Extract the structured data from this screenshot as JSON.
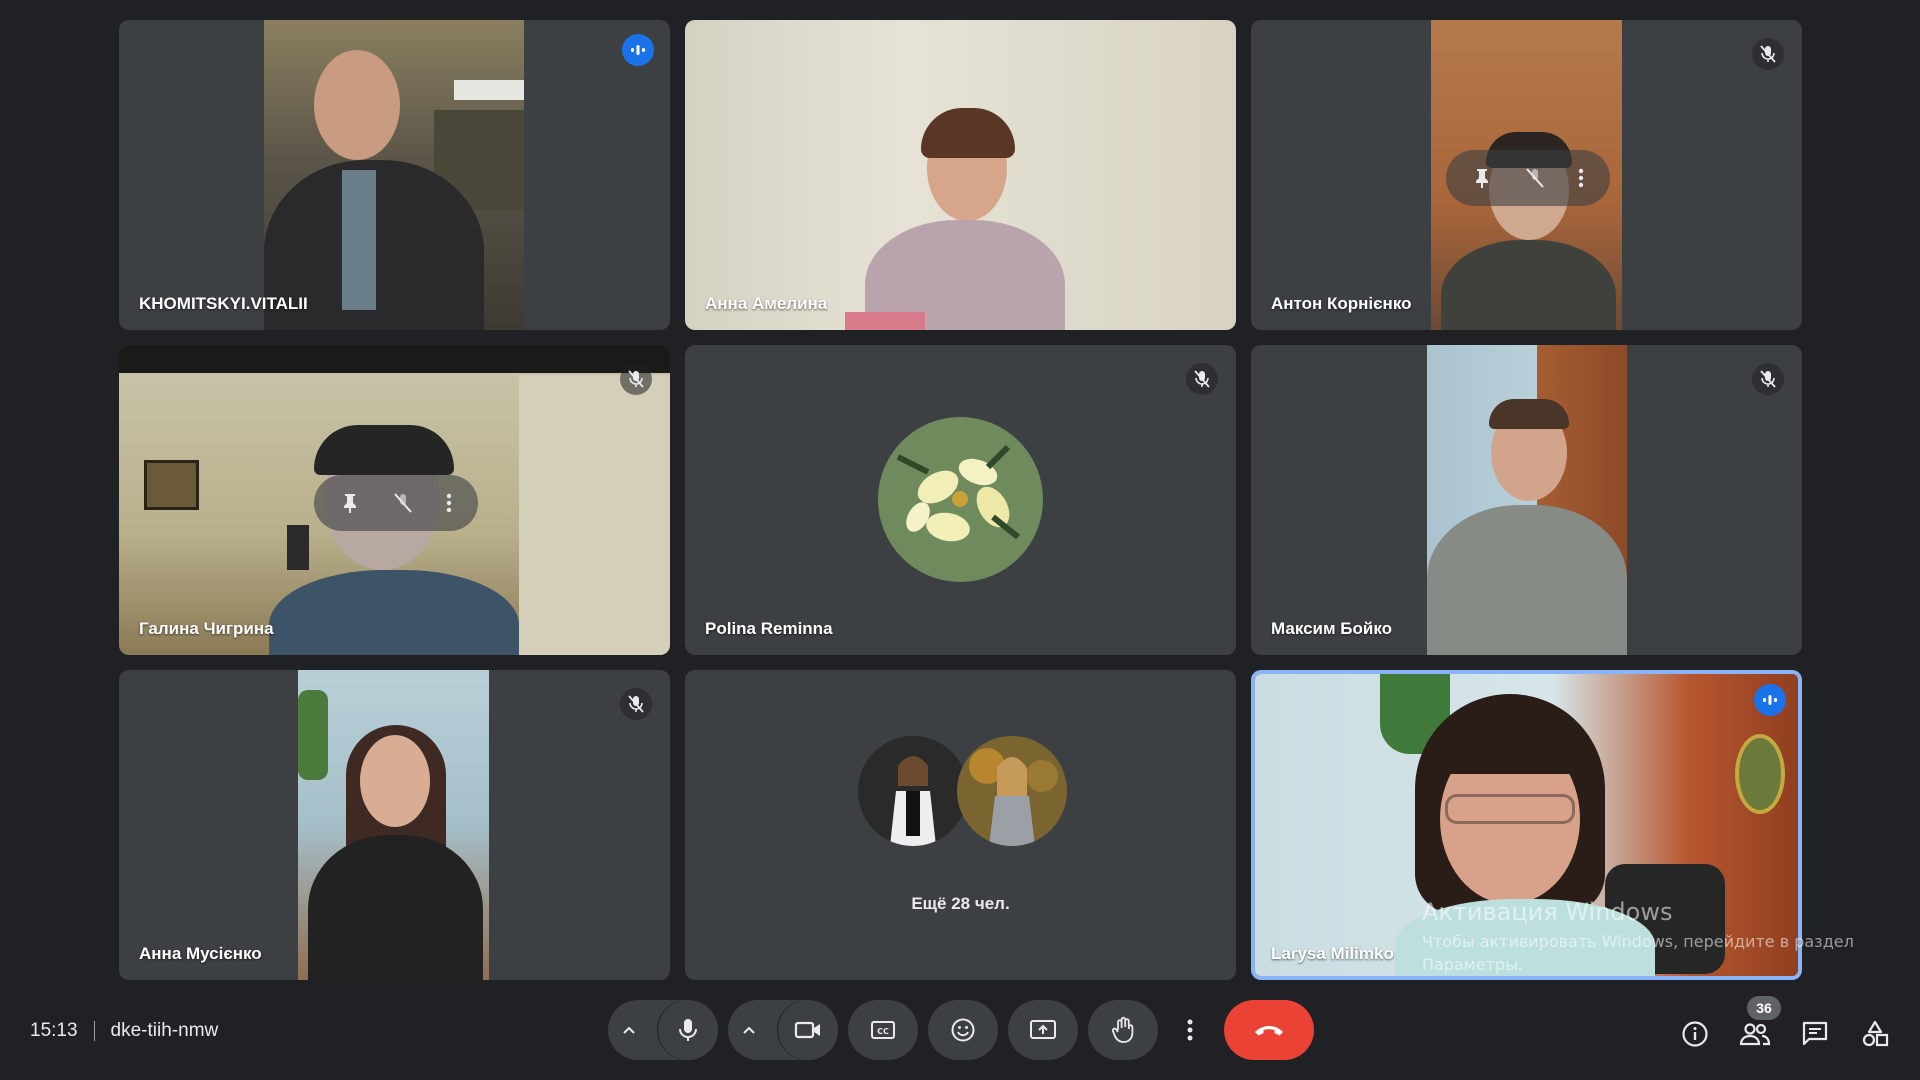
{
  "meeting": {
    "time": "15:13",
    "code": "dke-tiih-nmw"
  },
  "participants": [
    {
      "name": "KHOMITSKYI.VITALII",
      "state": "speaking"
    },
    {
      "name": "Анна Амелина",
      "state": "none"
    },
    {
      "name": "Антон Корнієнко",
      "state": "muted"
    },
    {
      "name": "Галина Чигрина",
      "state": "muted"
    },
    {
      "name": "Polina Reminna",
      "state": "muted"
    },
    {
      "name": "Максим Бойко",
      "state": "muted"
    },
    {
      "name": "Анна Мусієнко",
      "state": "muted"
    },
    {
      "name": "Larysa Milimko",
      "state": "speaking",
      "active": true
    }
  ],
  "others_tile": {
    "label": "Ещё 28 чел."
  },
  "toolbar": {
    "people_count": "36"
  },
  "watermark": {
    "line1": "Активация Windows",
    "line2": "Чтобы активировать Windows, перейдите в раздел",
    "line3": "Параметры."
  },
  "colors": {
    "background": "#202124",
    "tile": "#3c4043",
    "speaking": "#1a73e8",
    "active_border": "#8ab4f8",
    "end_call": "#ea4335"
  },
  "icons": [
    "mic-icon",
    "camera-icon",
    "captions-icon",
    "emoji-icon",
    "present-icon",
    "raise-hand-icon",
    "more-icon",
    "end-call-icon",
    "info-icon",
    "people-icon",
    "chat-icon",
    "activities-icon"
  ]
}
